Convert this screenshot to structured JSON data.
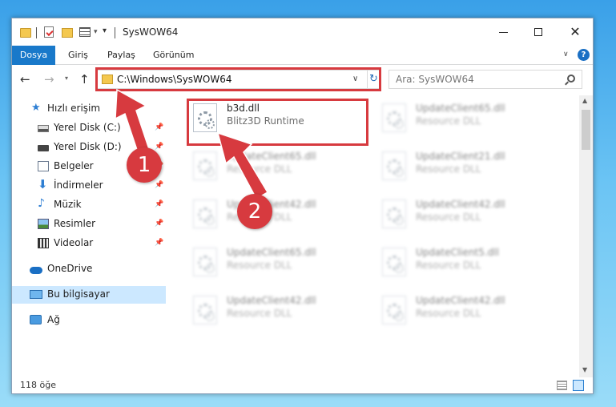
{
  "window": {
    "title": "SysWOW64",
    "controls": {
      "minimize": "—",
      "maximize": "",
      "close": "✕"
    }
  },
  "ribbon": {
    "tabs": [
      "Dosya",
      "Giriş",
      "Paylaş",
      "Görünüm"
    ],
    "help": "?"
  },
  "navbar": {
    "address": "C:\\Windows\\SysWOW64",
    "search_placeholder": "Ara: SysWOW64"
  },
  "sidebar": {
    "quick_access": "Hızlı erişim",
    "items": [
      {
        "label": "Yerel Disk (C:)",
        "pinned": true
      },
      {
        "label": "Yerel Disk (D:)",
        "pinned": true
      },
      {
        "label": "Belgeler",
        "pinned": true
      },
      {
        "label": "İndirmeler",
        "pinned": true
      },
      {
        "label": "Müzik",
        "pinned": true
      },
      {
        "label": "Resimler",
        "pinned": true
      },
      {
        "label": "Videolar",
        "pinned": true
      }
    ],
    "onedrive": "OneDrive",
    "this_pc": "Bu bilgisayar",
    "network": "Ağ"
  },
  "files": [
    {
      "name": "b3d.dll",
      "desc": "Blitz3D Runtime",
      "highlighted": true
    },
    {
      "name": "UpdateClient65.dll",
      "desc": "Resource DLL"
    },
    {
      "name": "UpdateClient65.dll",
      "desc": "Resource DLL"
    },
    {
      "name": "UpdateClient21.dll",
      "desc": "Resource DLL"
    },
    {
      "name": "UpdateClient42.dll",
      "desc": "Resource DLL"
    },
    {
      "name": "UpdateClient42.dll",
      "desc": "Resource DLL"
    },
    {
      "name": "UpdateClient65.dll",
      "desc": "Resource DLL"
    },
    {
      "name": "UpdateClient5.dll",
      "desc": "Resource DLL"
    },
    {
      "name": "UpdateClient42.dll",
      "desc": "Resource DLL"
    },
    {
      "name": "UpdateClient42.dll",
      "desc": "Resource DLL"
    }
  ],
  "status": {
    "count": "118 öğe"
  },
  "markers": {
    "one": "1",
    "two": "2"
  },
  "colors": {
    "accent": "#1979ca",
    "highlight": "#d73a3f",
    "selection": "#cce8ff"
  }
}
